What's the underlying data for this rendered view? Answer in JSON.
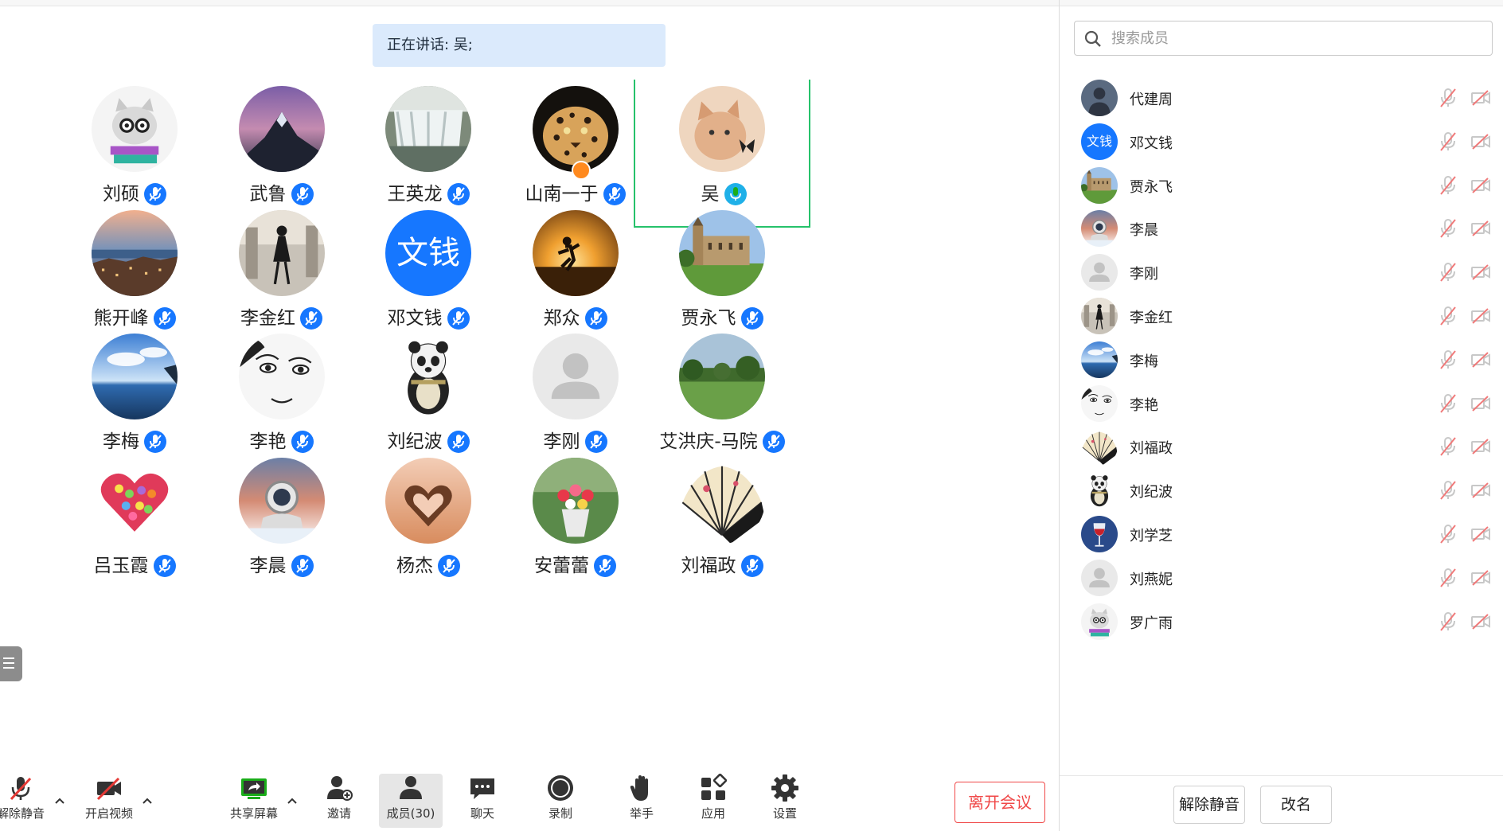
{
  "speaking": {
    "label": "正在讲话: 吴;"
  },
  "grid": [
    {
      "name": "刘硕",
      "avatar": "cat-glasses"
    },
    {
      "name": "武鲁",
      "avatar": "galaxy-mountain"
    },
    {
      "name": "王英龙",
      "avatar": "waterfall"
    },
    {
      "name": "山南一于",
      "avatar": "leopard",
      "host": true
    },
    {
      "name": "吴",
      "avatar": "kitten",
      "speaking": true
    },
    {
      "name": "熊开峰",
      "avatar": "coastal-town"
    },
    {
      "name": "李金红",
      "avatar": "dancer"
    },
    {
      "name": "邓文钱",
      "avatar_text": "文钱"
    },
    {
      "name": "郑众",
      "avatar": "sunset-runner"
    },
    {
      "name": "贾永飞",
      "avatar": "castle-lawn"
    },
    {
      "name": "李梅",
      "avatar": "sky-sea"
    },
    {
      "name": "李艳",
      "avatar": "sketch-face"
    },
    {
      "name": "刘纪波",
      "avatar": "panda"
    },
    {
      "name": "李刚",
      "avatar": "default-user"
    },
    {
      "name": "艾洪庆-马院",
      "avatar": "park"
    },
    {
      "name": "吕玉霞",
      "avatar": "candy-heart"
    },
    {
      "name": "李晨",
      "avatar": "astronaut"
    },
    {
      "name": "杨杰",
      "avatar": "heart-hands"
    },
    {
      "name": "安蕾蕾",
      "avatar": "flower-bouquet"
    },
    {
      "name": "刘福政",
      "avatar": "folding-fan"
    }
  ],
  "toolbar": {
    "unmute": "解除静音",
    "start_video": "开启视频",
    "share_screen": "共享屏幕",
    "invite": "邀请",
    "members": "成员(30)",
    "chat": "聊天",
    "record": "录制",
    "raise_hand": "举手",
    "apps": "应用",
    "settings": "设置",
    "leave": "离开会议"
  },
  "panel": {
    "search_placeholder": "搜索成员",
    "members": [
      {
        "name": "代建周",
        "avatar": "dark-portrait"
      },
      {
        "name": "邓文钱",
        "avatar_text": "文钱"
      },
      {
        "name": "贾永飞",
        "avatar": "castle-lawn"
      },
      {
        "name": "李晨",
        "avatar": "astronaut"
      },
      {
        "name": "李刚",
        "avatar": "default-user"
      },
      {
        "name": "李金红",
        "avatar": "dancer"
      },
      {
        "name": "李梅",
        "avatar": "sky-sea"
      },
      {
        "name": "李艳",
        "avatar": "sketch-face"
      },
      {
        "name": "刘福政",
        "avatar": "folding-fan"
      },
      {
        "name": "刘纪波",
        "avatar": "panda"
      },
      {
        "name": "刘学芝",
        "avatar": "wine-glass"
      },
      {
        "name": "刘燕妮",
        "avatar": "default-user"
      },
      {
        "name": "罗广雨",
        "avatar": "cat-glasses"
      }
    ],
    "unmute_all": "解除静音",
    "rename": "改名"
  },
  "colors": {
    "accent": "#1677ff",
    "speaking_border": "#26c26b",
    "danger": "#f04848",
    "speaking_bg": "#dbeafc"
  }
}
